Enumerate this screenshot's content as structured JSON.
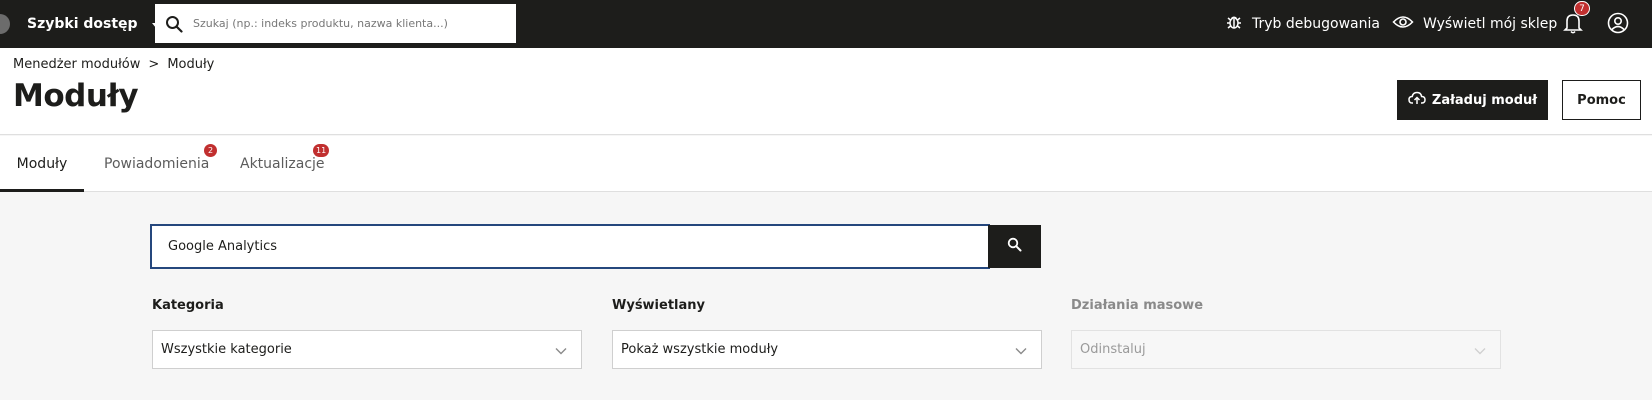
{
  "topbar": {
    "quick_access_label": "Szybki dostęp",
    "search_placeholder": "Szukaj (np.: indeks produktu, nazwa klienta...)",
    "debug_label": "Tryb debugowania",
    "view_shop_label": "Wyświetl mój sklep",
    "notifications_count": "7"
  },
  "header": {
    "breadcrumb": [
      "Menedżer modułów",
      ">",
      "Moduły"
    ],
    "title": "Moduły",
    "upload_label": "Załaduj moduł",
    "help_label": "Pomoc"
  },
  "tabs": [
    {
      "label": "Moduły",
      "active": true
    },
    {
      "label": "Powiadomienia",
      "badge": "2"
    },
    {
      "label": "Aktualizacje",
      "badge": "11"
    }
  ],
  "search": {
    "value": "Google Analytics"
  },
  "filters": {
    "category": {
      "label": "Kategoria",
      "value": "Wszystkie kategorie"
    },
    "display": {
      "label": "Wyświetlany",
      "value": "Pokaż wszystkie moduły"
    },
    "bulk": {
      "label": "Działania masowe",
      "value": "Odinstaluj",
      "disabled": true
    }
  },
  "colors": {
    "topbar_bg": "#1d1d1b",
    "badge": "#c12f2f",
    "focus_border": "#25477d"
  },
  "icons": [
    "search-icon",
    "bug-icon",
    "eye-icon",
    "bell-icon",
    "account-icon",
    "cloud-upload-icon",
    "chevron-down-icon"
  ]
}
